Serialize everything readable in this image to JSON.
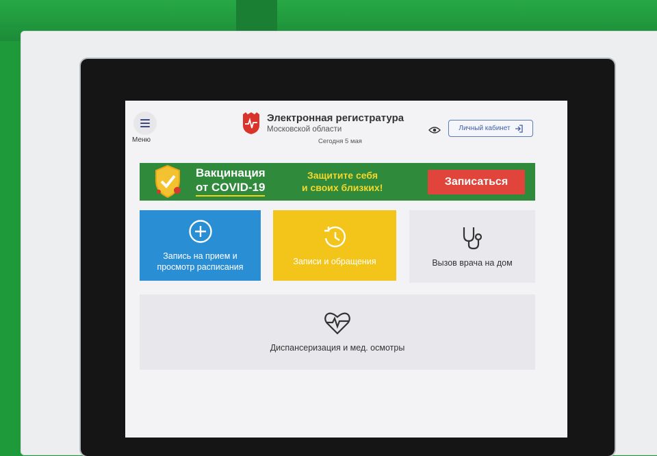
{
  "header": {
    "menu_label": "Меню",
    "title": "Электронная регистратура",
    "subtitle": "Московской области",
    "date": "Сегодня 5 мая",
    "cabinet_label": "Личный кабинет"
  },
  "banner": {
    "line1": "Вакцинация",
    "line2": "от COVID-19",
    "slogan1": "Защитите себя",
    "slogan2": "и своих близких!",
    "button_label": "Записаться"
  },
  "tiles": [
    {
      "line1": "Запись на прием и",
      "line2": "просмотр расписания",
      "icon": "plus-circle-icon"
    },
    {
      "line1": "Записи и обращения",
      "icon": "history-icon"
    },
    {
      "line1": "Вызов врача на дом",
      "icon": "stethoscope-icon"
    },
    {
      "line1": "Диспансеризация и мед. осмотры",
      "icon": "heartbeat-icon"
    }
  ],
  "colors": {
    "banner_green": "#2f8a3c",
    "banner_button": "#e0443a",
    "tile_blue": "#2a8ed4",
    "tile_yellow": "#f3c51a",
    "accent": "#f6d82a"
  }
}
